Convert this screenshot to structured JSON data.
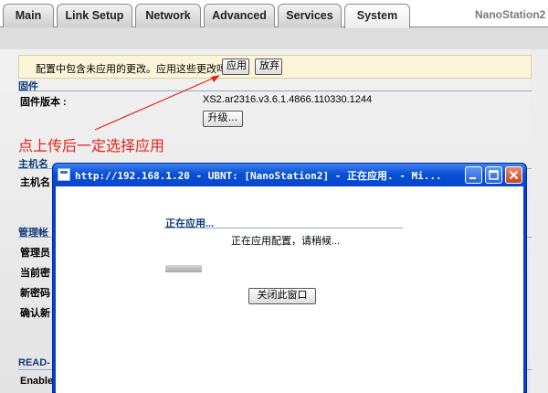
{
  "tabs": [
    {
      "label": "Main",
      "active": false
    },
    {
      "label": "Link Setup",
      "active": false
    },
    {
      "label": "Network",
      "active": false
    },
    {
      "label": "Advanced",
      "active": false
    },
    {
      "label": "Services",
      "active": false
    },
    {
      "label": "System",
      "active": true
    }
  ],
  "brand": "NanoStation2",
  "banner": {
    "text": "配置中包含未应用的更改。应用这些更改吗?",
    "apply_label": "应用",
    "discard_label": "放弃"
  },
  "firmware": {
    "section_title": "固件",
    "version_label": "固件版本 :",
    "version_value": "XS2.ar2316.v3.6.1.4866.110330.1244",
    "upgrade_label": "升级…"
  },
  "annotation": "点上传后一定选择应用",
  "host": {
    "section_title": "主机名",
    "field_label": "主机名"
  },
  "admin": {
    "section_title": "管理帐",
    "fields": [
      "管理员",
      "当前密",
      "新密码",
      "确认新"
    ]
  },
  "readonly": {
    "section_title": "READ-",
    "field_label": "Enable"
  },
  "popup": {
    "title": "http://192.168.1.20 - UBNT: [NanoStation2] - 正在应用. - Mi...",
    "heading": "正在应用...",
    "message": "正在应用配置，请稍候...",
    "close_label": "关闭此窗口",
    "progress": 0.15
  },
  "colors": {
    "section_title": "#123a7a",
    "annotation": "#e2231a",
    "titlebar": "#0b4fd6",
    "banner_bg": "#fbf6d9"
  }
}
